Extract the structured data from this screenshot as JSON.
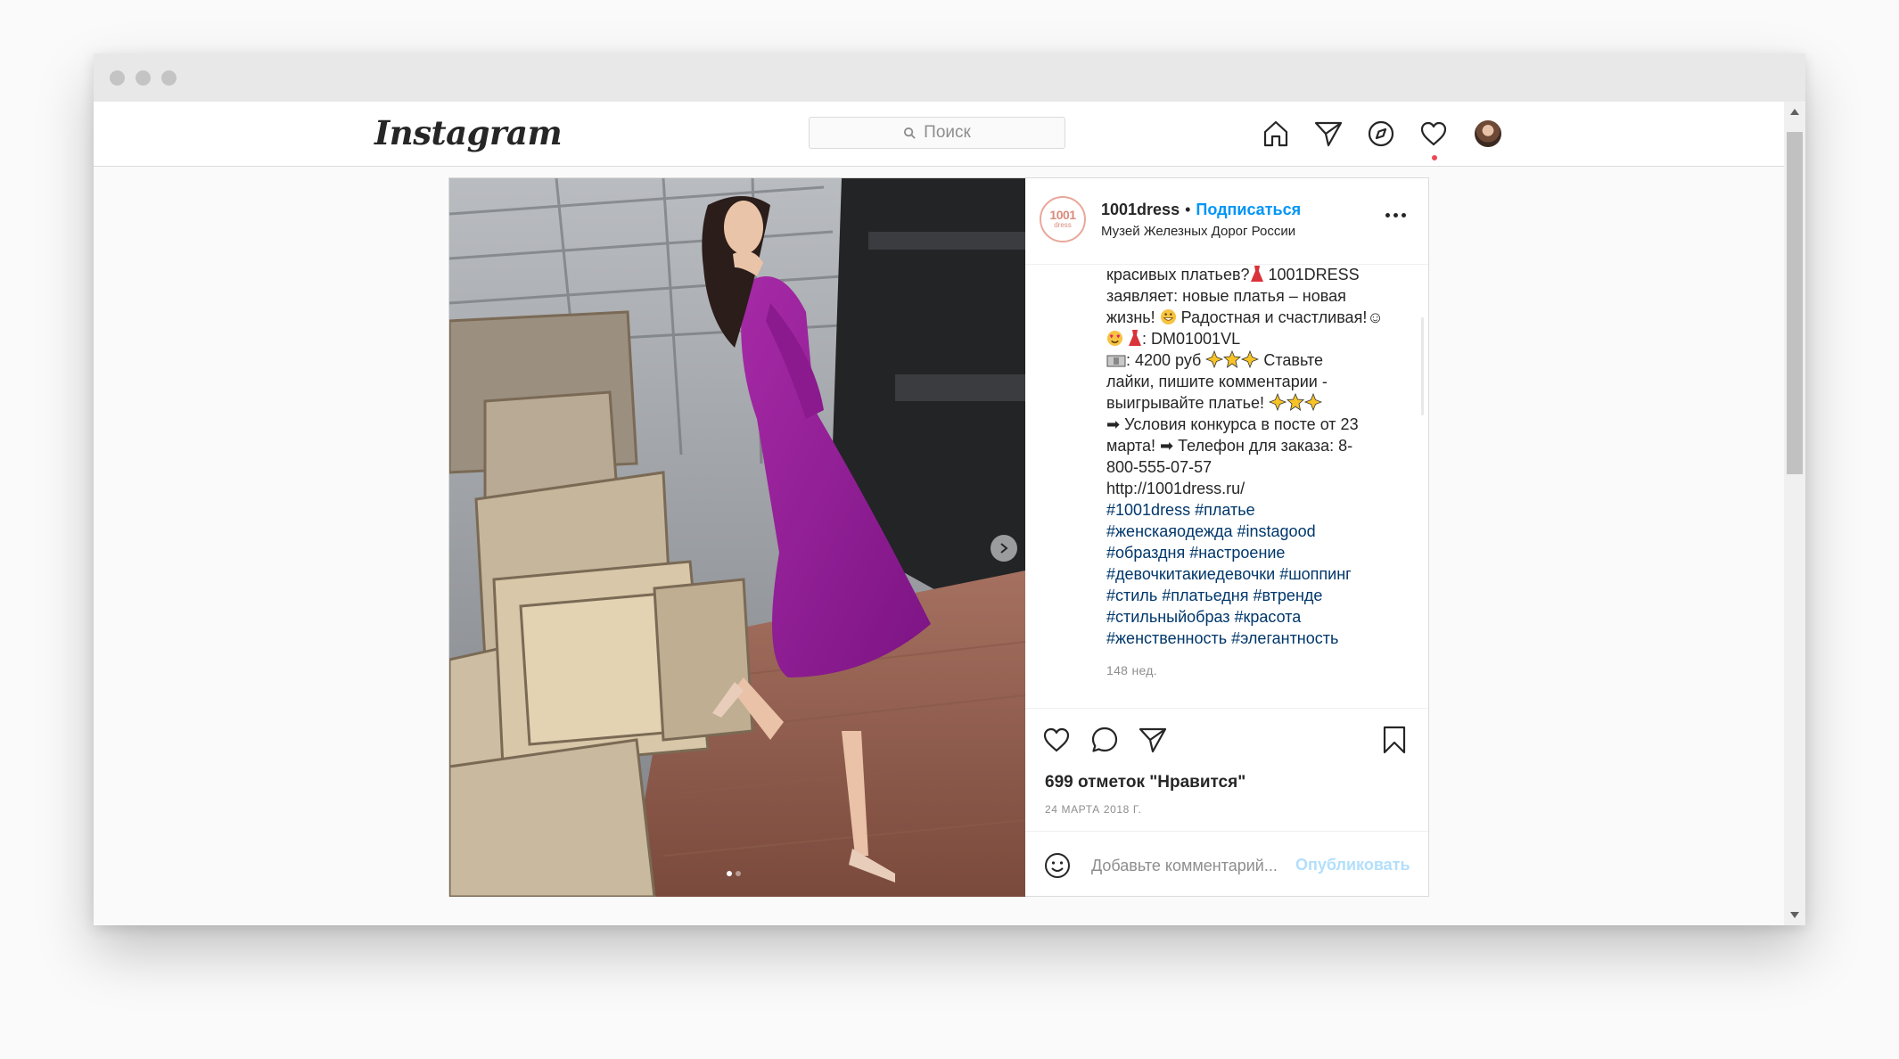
{
  "header": {
    "logo_text": "Instagram",
    "search_placeholder": "Поиск"
  },
  "post": {
    "username": "1001dress",
    "separator": "•",
    "follow_label": "Подписаться",
    "location": "Музей Железных Дорог России",
    "avatar_text_top": "1001",
    "avatar_text_bottom": "dress",
    "caption_lines": [
      {
        "text": "красивых платьев?",
        "emoji_after": "dress"
      },
      {
        "text": " 1001DRESS"
      },
      {
        "text": "заявляет: новые платья – новая"
      },
      {
        "text": "жизнь! "
      },
      {
        "text": " Радостная и счастливая!☺"
      },
      {
        "text": " "
      },
      {
        "text": ": DM01001VL"
      },
      {
        "text": ": 4200 руб "
      },
      {
        "text": " Ставьте"
      },
      {
        "text": "лайки, пишите комментарии -"
      },
      {
        "text": "выигрывайте платье! "
      },
      {
        "text": "➡ Условия конкурса в посте от 23"
      },
      {
        "text": "марта! ➡ Телефон для заказа: 8-"
      },
      {
        "text": "800-555-07-57"
      },
      {
        "text": "http://1001dress.ru/"
      }
    ],
    "hashtag_lines": [
      "#1001dress #платье",
      "#женскаяодежда #instagood",
      "#образдня #настроение",
      "#девочкитакиедевочки #шоппинг",
      "#стиль #платьедня #втренде",
      "#стильныйобраз #красота",
      "#женственность #элегантность"
    ],
    "time_ago": "148 нед.",
    "likes_text": "699 отметок \"Нравится\"",
    "date": "24 МАРТА 2018 Г.",
    "comment_placeholder": "Добавьте комментарий...",
    "publish_label": "Опубликовать",
    "carousel": {
      "total": 2,
      "current": 1
    }
  },
  "colors": {
    "link_blue": "#0095f6",
    "hashtag": "#00376b",
    "notification": "#ed4956",
    "dress": "#9b1d9b"
  },
  "icons": {
    "nav": [
      "home-icon",
      "direct-icon",
      "explore-icon",
      "heart-icon"
    ],
    "actions": [
      "like-icon",
      "comment-icon",
      "share-icon",
      "bookmark-icon"
    ],
    "comment": "smile-icon"
  }
}
